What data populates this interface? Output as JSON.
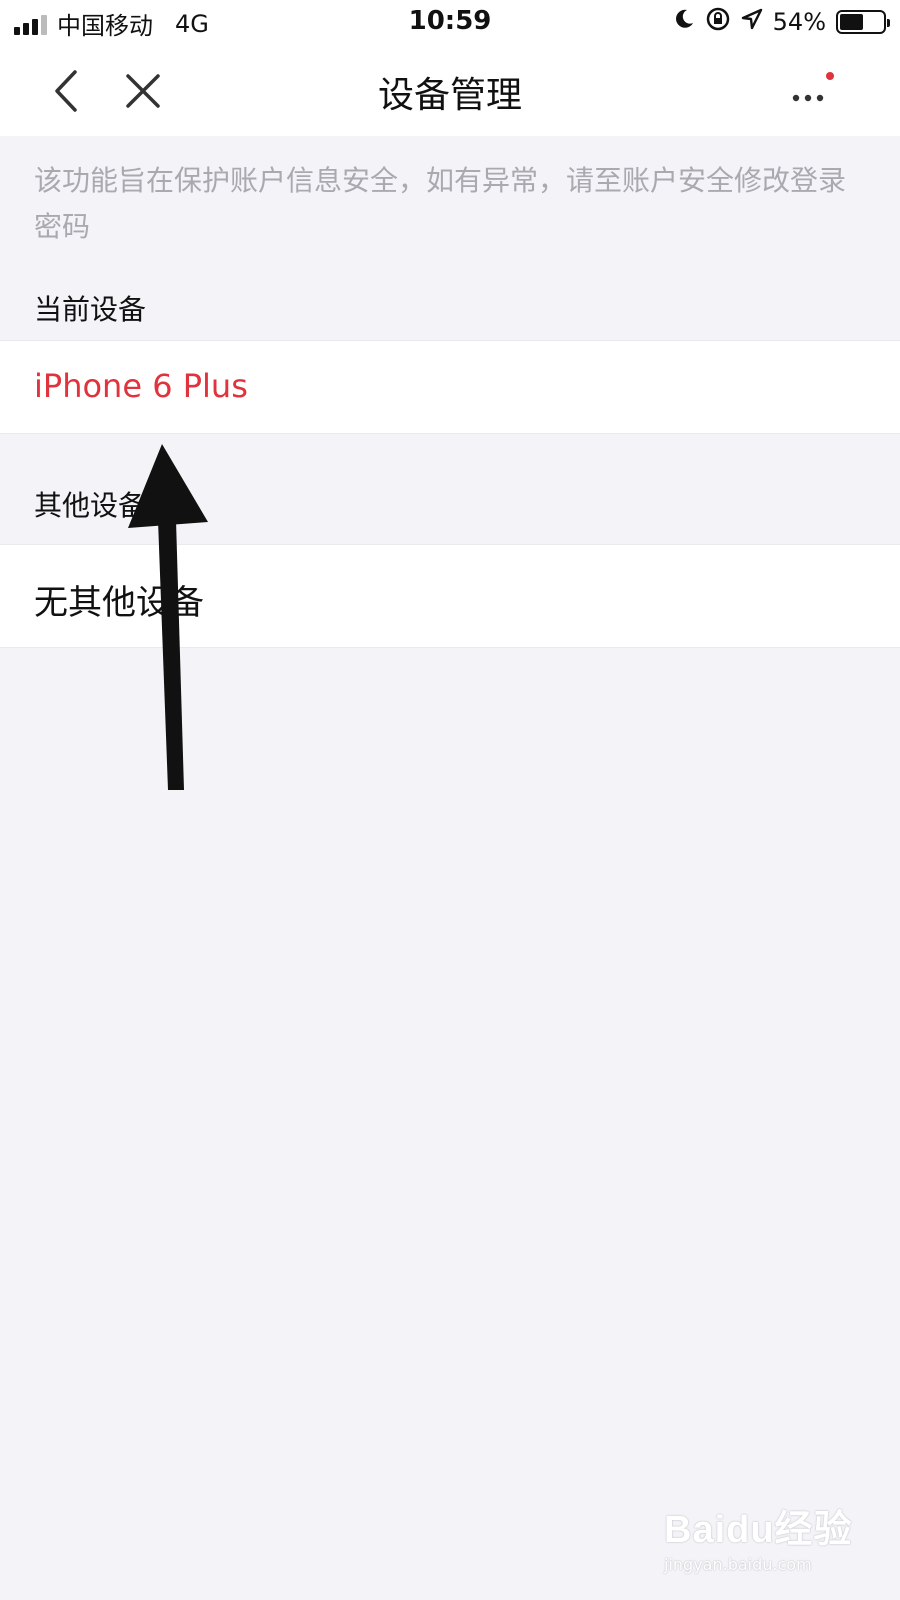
{
  "status_bar": {
    "carrier": "中国移动",
    "network": "4G",
    "time": "10:59",
    "battery_percent": "54%",
    "battery_level": 0.54,
    "icons": [
      "moon-icon",
      "rotation-lock-icon",
      "location-icon",
      "battery-icon"
    ]
  },
  "nav": {
    "title": "设备管理",
    "back_icon": "chevron-left-icon",
    "close_icon": "close-icon",
    "more_icon": "more-dots-icon",
    "more_badge_color": "#e0333d"
  },
  "notice": "该功能旨在保护账户信息安全，如有异常，请至账户安全修改登录密码",
  "sections": {
    "current_label": "当前设备",
    "current_device": "iPhone 6 Plus",
    "other_label": "其他设备",
    "other_device": "无其他设备"
  },
  "colors": {
    "accent_red": "#e0333d",
    "background": "#f4f4f8",
    "muted_text": "#a9a9b0"
  },
  "watermark": {
    "logo": "Baidu经验",
    "url": "jingyan.baidu.com"
  }
}
